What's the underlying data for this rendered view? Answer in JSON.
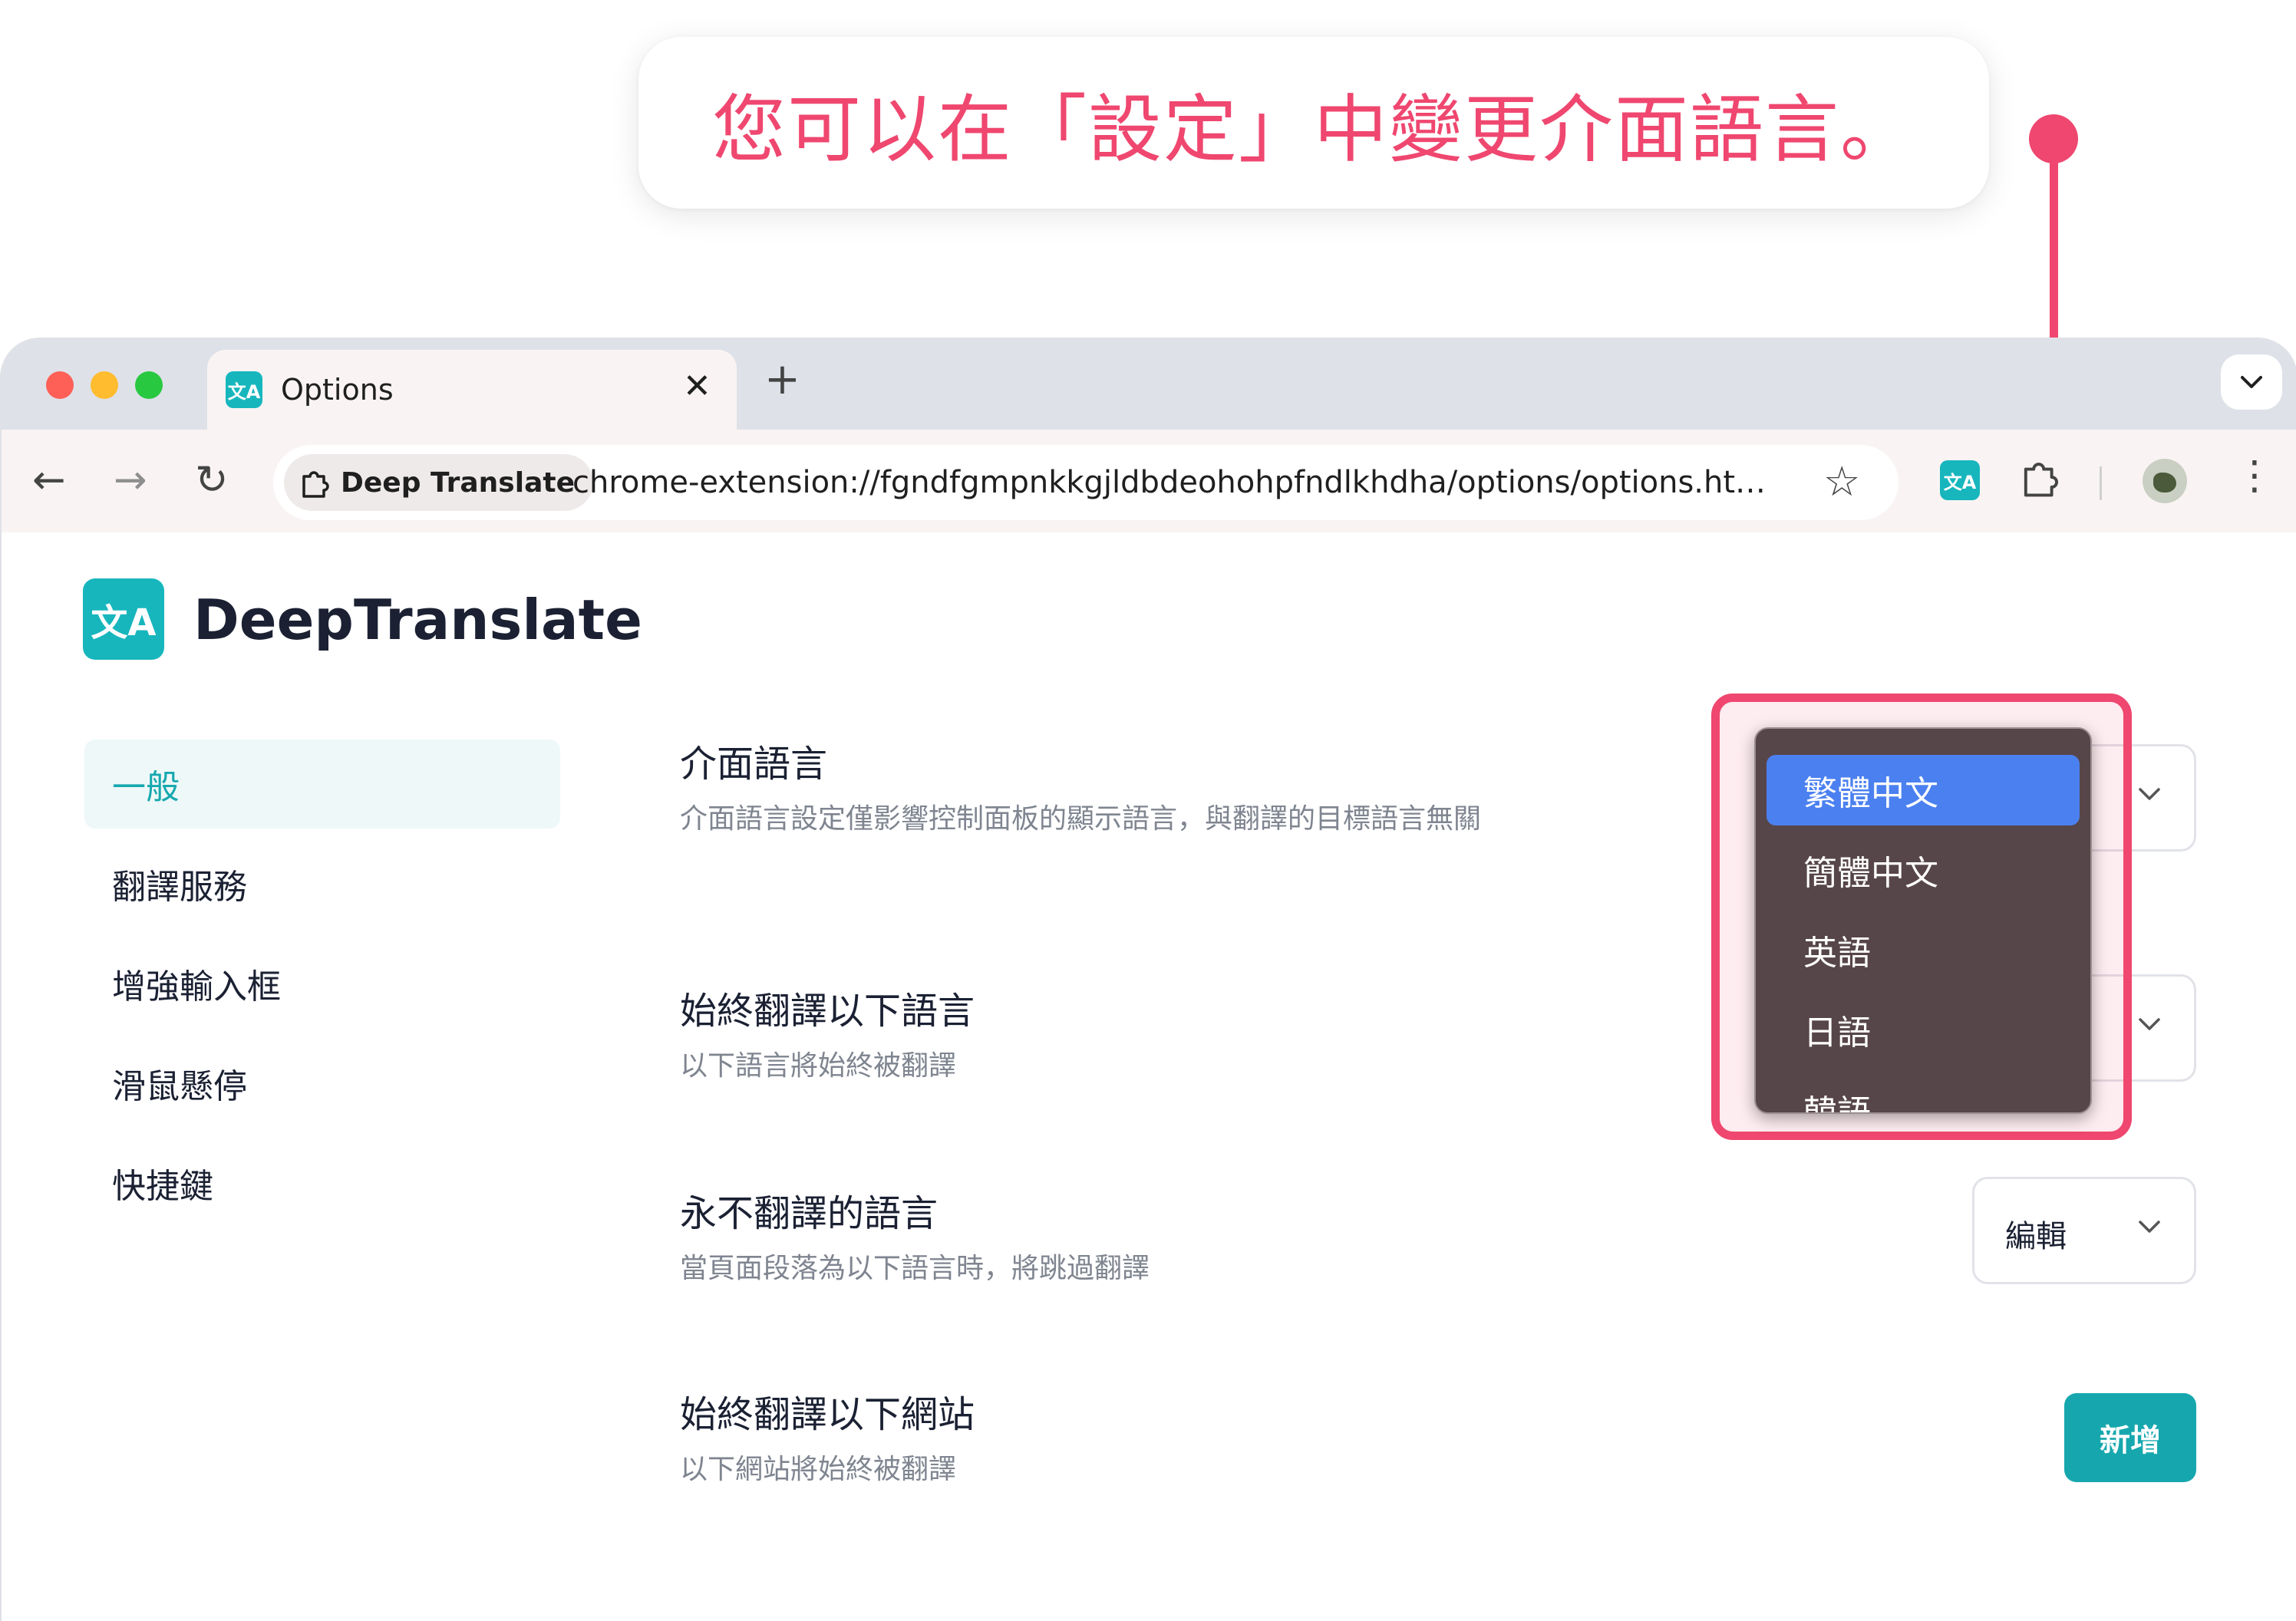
{
  "callout": {
    "text": "您可以在「設定」中變更介面語言。"
  },
  "browser": {
    "tab_title": "Options",
    "chip_label": "Deep Translate",
    "url": "chrome-extension://fgndfgmpnkkgjldbdeohohpfndlkhdha/options/options.html#..."
  },
  "app": {
    "name": "DeepTranslate"
  },
  "sidebar": {
    "items": [
      {
        "label": "一般"
      },
      {
        "label": "翻譯服務"
      },
      {
        "label": "增強輸入框"
      },
      {
        "label": "滑鼠懸停"
      },
      {
        "label": "快捷鍵"
      }
    ]
  },
  "settings": {
    "ui_language": {
      "title": "介面語言",
      "desc": "介面語言設定僅影響控制面板的顯示語言，與翻譯的目標語言無關"
    },
    "always_translate_lang": {
      "title": "始終翻譯以下語言",
      "desc": "以下語言將始終被翻譯"
    },
    "never_translate_lang": {
      "title": "永不翻譯的語言",
      "desc": "當頁面段落為以下語言時，將跳過翻譯",
      "select_value": "編輯"
    },
    "always_translate_sites": {
      "title": "始終翻譯以下網站",
      "desc": "以下網站將始終被翻譯",
      "button": "新增"
    }
  },
  "dropdown": {
    "options": [
      "繁體中文",
      "簡體中文",
      "英語",
      "日語",
      "韓語"
    ],
    "selected": "繁體中文"
  },
  "colors": {
    "accent": "#17b6bd",
    "callout": "#ef476f",
    "dropdown_bg": "#574649",
    "dropdown_selected": "#4b80f0"
  }
}
